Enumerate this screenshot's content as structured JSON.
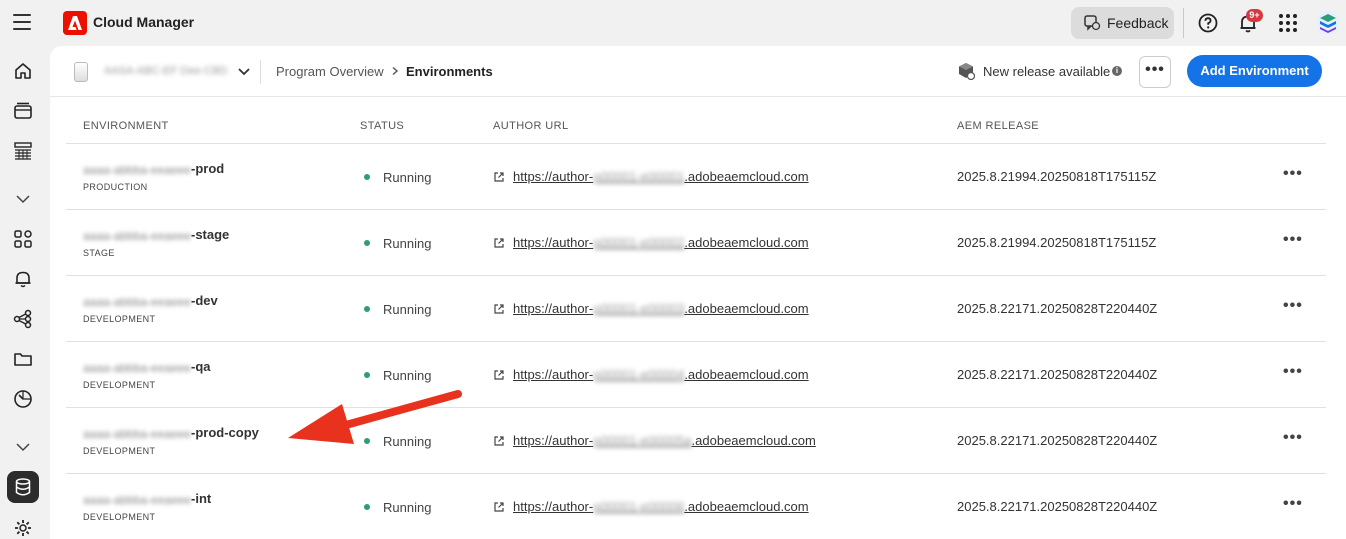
{
  "app": {
    "title": "Cloud Manager"
  },
  "topbar": {
    "feedback_label": "Feedback",
    "notification_badge": "9+",
    "icons": [
      "menu-icon",
      "help-icon",
      "bell-icon",
      "apps-grid-icon",
      "avatar"
    ]
  },
  "leftrail": {
    "icons": [
      "home-icon",
      "card-stack-icon",
      "pipeline-icon",
      "chevron-down-icon",
      "grid-icon",
      "bell-icon",
      "workflow-icon",
      "folder-icon",
      "gauge-icon",
      "chevron-down-icon",
      "database-icon",
      "gear-icon"
    ],
    "active": "database-icon"
  },
  "subheader": {
    "program_name": "AASA-ABC-EF Dee-CBD",
    "breadcrumb": [
      "Program Overview",
      "Environments"
    ],
    "release_notice": "New release available",
    "add_button": "Add Environment"
  },
  "table": {
    "columns": [
      "ENVIRONMENT",
      "STATUS",
      "AUTHOR URL",
      "AEM RELEASE"
    ],
    "rows": [
      {
        "name_prefix": "aaaa-abbba-eeaeee",
        "name_suffix": "-prod",
        "type": "PRODUCTION",
        "status": "Running",
        "url_prefix": "https://author-",
        "url_hidden": "p00001-e00001",
        "url_suffix": ".adobeaemcloud.com",
        "release": "2025.8.21994.20250818T175115Z"
      },
      {
        "name_prefix": "aaaa-abbba-eeaeee",
        "name_suffix": "-stage",
        "type": "STAGE",
        "status": "Running",
        "url_prefix": "https://author-",
        "url_hidden": "p00001-e00002",
        "url_suffix": ".adobeaemcloud.com",
        "release": "2025.8.21994.20250818T175115Z"
      },
      {
        "name_prefix": "aaaa-abbba-eeaeee",
        "name_suffix": "-dev",
        "type": "DEVELOPMENT",
        "status": "Running",
        "url_prefix": "https://author-",
        "url_hidden": "p00001-e00003",
        "url_suffix": ".adobeaemcloud.com",
        "release": "2025.8.22171.20250828T220440Z"
      },
      {
        "name_prefix": "aaaa-abbba-eeaeee",
        "name_suffix": "-qa",
        "type": "DEVELOPMENT",
        "status": "Running",
        "url_prefix": "https://author-",
        "url_hidden": "p00001-e00004",
        "url_suffix": ".adobeaemcloud.com",
        "release": "2025.8.22171.20250828T220440Z"
      },
      {
        "name_prefix": "aaaa-abbba-eeaeee",
        "name_suffix": "-prod-copy",
        "type": "DEVELOPMENT",
        "status": "Running",
        "url_prefix": "https://author-",
        "url_hidden": "p00001-e00005a",
        "url_suffix": ".adobeaemcloud.com",
        "release": "2025.8.22171.20250828T220440Z"
      },
      {
        "name_prefix": "aaaa-abbba-eeaeee",
        "name_suffix": "-int",
        "type": "DEVELOPMENT",
        "status": "Running",
        "url_prefix": "https://author-",
        "url_hidden": "p00001-e00006",
        "url_suffix": ".adobeaemcloud.com",
        "release": "2025.8.22171.20250828T220440Z"
      }
    ]
  },
  "colors": {
    "accent": "#1473e6",
    "running": "#2d9d78",
    "adobe_red": "#eb1000",
    "annotation_arrow": "#e8321e"
  }
}
